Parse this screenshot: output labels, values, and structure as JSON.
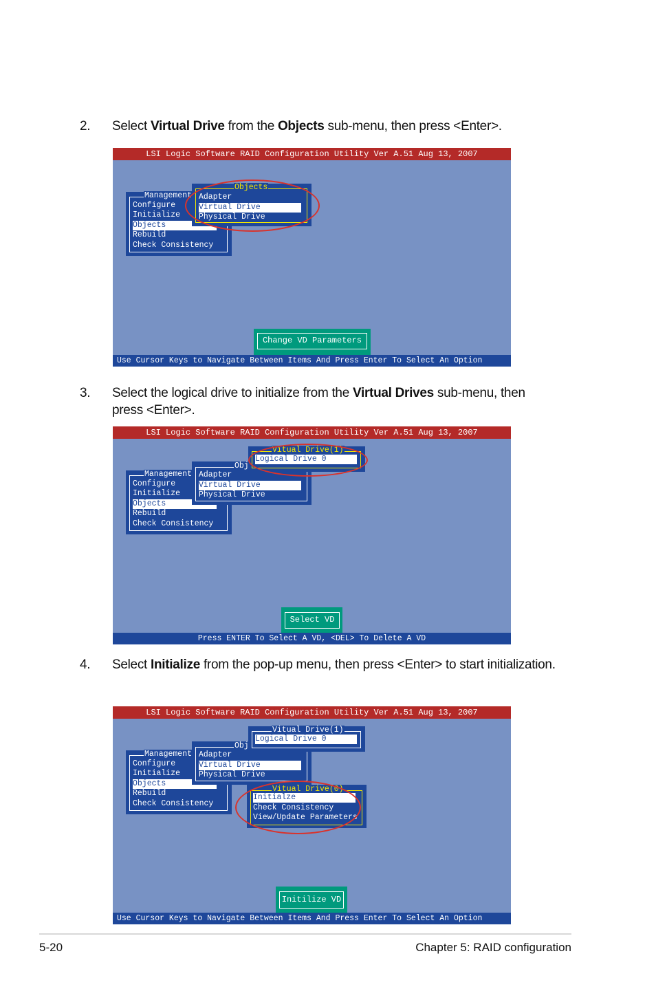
{
  "steps": [
    {
      "number": "2.",
      "pre": "Select ",
      "b1": "Virtual Drive",
      "mid": " from the ",
      "b2": "Objects",
      "post": " sub-menu, then press <Enter>."
    },
    {
      "number": "3.",
      "pre": "Select the logical drive to initialize from the ",
      "b1": "Virtual Drives",
      "post": " sub-menu, then press <Enter>."
    },
    {
      "number": "4.",
      "pre": "Select ",
      "b1": "Initialize",
      "post": " from the pop-up menu, then press <Enter> to start initialization."
    }
  ],
  "screens": [
    {
      "title": "LSI Logic Software RAID Configuration Utility Ver A.51 Aug 13, 2007",
      "management": {
        "title": "Management",
        "items": [
          "Configure",
          "Initialize",
          "Objects",
          "Rebuild",
          "Check Consistency"
        ],
        "selected": "Objects"
      },
      "objects": {
        "title": "Objects",
        "items": [
          "Adapter",
          "Virtual Drive",
          "Physical Drive"
        ],
        "selected": "Virtual Drive"
      },
      "action": "Change VD Parameters",
      "status": "Use Cursor Keys to Navigate Between Items And Press Enter To Select An Option"
    },
    {
      "title": "LSI Logic Software RAID Configuration Utility Ver A.51 Aug 13, 2007",
      "management": {
        "title": "Management",
        "items": [
          "Configure",
          "Initialize",
          "Objects",
          "Rebuild",
          "Check Consistency"
        ],
        "selected": "Objects"
      },
      "objects": {
        "title": "Obj",
        "items": [
          "Adapter",
          "Virtual Drive",
          "Physical Drive"
        ],
        "selected": "Virtual Drive"
      },
      "vd_list": {
        "title": "Vitual Drive(1)",
        "items": [
          "Logical Drive 0"
        ],
        "selected": "Logical Drive 0"
      },
      "action": "Select VD",
      "status": "Press ENTER To Select A VD, <DEL> To Delete A VD"
    },
    {
      "title": "LSI Logic Software RAID Configuration Utility Ver A.51 Aug 13, 2007",
      "management": {
        "title": "Management",
        "items": [
          "Configure",
          "Initialize",
          "Objects",
          "Rebuild",
          "Check Consistency"
        ],
        "selected": "Objects"
      },
      "objects": {
        "title": "Obj",
        "items": [
          "Adapter",
          "Virtual Drive",
          "Physical Drive"
        ],
        "selected": "Virtual Drive"
      },
      "vd_list": {
        "title": "Vitual Drive(1)",
        "items": [
          "Logical Drive 0"
        ],
        "selected": "Logical Drive 0"
      },
      "vd_menu": {
        "title": "Vitual Drive(0)",
        "items": [
          "Initialze",
          "Check Consistency",
          "View/Update Parameters"
        ],
        "selected": "Initialze"
      },
      "action": "Initilize VD",
      "status": "Use Cursor Keys to Navigate Between Items And Press Enter To Select An Option"
    }
  ],
  "footer": {
    "page": "5-20",
    "chapter": "Chapter 5: RAID configuration"
  },
  "colors": {
    "background": "#7892c4",
    "menu": "#1e479a",
    "titlebar": "#b42a28",
    "action": "#009a7d",
    "highlight_frame": "#f2e600",
    "callout": "#d9332c"
  }
}
